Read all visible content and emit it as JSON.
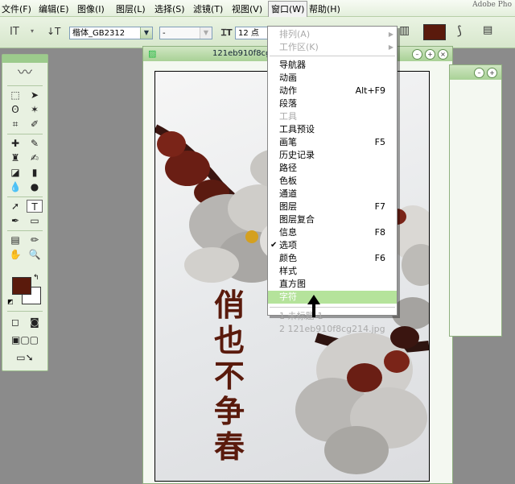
{
  "app": {
    "title_fragment": "Adobe Pho"
  },
  "menubar": [
    {
      "label": "文件(F)"
    },
    {
      "label": "编辑(E)"
    },
    {
      "label": "图像(I)"
    },
    {
      "label": "图层(L)"
    },
    {
      "label": "选择(S)"
    },
    {
      "label": "滤镜(T)"
    },
    {
      "label": "视图(V)"
    },
    {
      "label": "窗口(W)"
    },
    {
      "label": "帮助(H)"
    }
  ],
  "options": {
    "tool_glyph": "IT",
    "font_family": "楷体_GB2312",
    "font_style": "-",
    "font_size": "12 点",
    "text_color": "#5a1a0c"
  },
  "toolbox": {
    "foreground_color": "#5a1a0c",
    "background_color": "#ffffff"
  },
  "document": {
    "title": "121eb910f8cg2"
  },
  "canvas": {
    "text_chars": [
      "俏",
      "也",
      "不",
      "争",
      "春"
    ]
  },
  "window_menu": {
    "items": [
      {
        "label": "排列(A)",
        "disabled": true,
        "submenu": true
      },
      {
        "label": "工作区(K)",
        "disabled": true,
        "submenu": true
      },
      {
        "label": "导航器"
      },
      {
        "label": "动画"
      },
      {
        "label": "动作",
        "shortcut": "Alt+F9"
      },
      {
        "label": "段落"
      },
      {
        "label": "工具",
        "disabled": true
      },
      {
        "label": "工具预设"
      },
      {
        "label": "画笔",
        "shortcut": "F5"
      },
      {
        "label": "历史记录"
      },
      {
        "label": "路径"
      },
      {
        "label": "色板"
      },
      {
        "label": "通道"
      },
      {
        "label": "图层",
        "shortcut": "F7"
      },
      {
        "label": "图层复合"
      },
      {
        "label": "信息",
        "shortcut": "F8"
      },
      {
        "label": "选项",
        "checked": true
      },
      {
        "label": "颜色",
        "shortcut": "F6"
      },
      {
        "label": "样式"
      },
      {
        "label": "直方图"
      },
      {
        "label": "字符",
        "highlighted": true
      },
      {
        "label": "1 未标题-1",
        "disabled": true
      },
      {
        "label": "2 121eb910f8cg214.jpg",
        "disabled": true
      }
    ]
  }
}
